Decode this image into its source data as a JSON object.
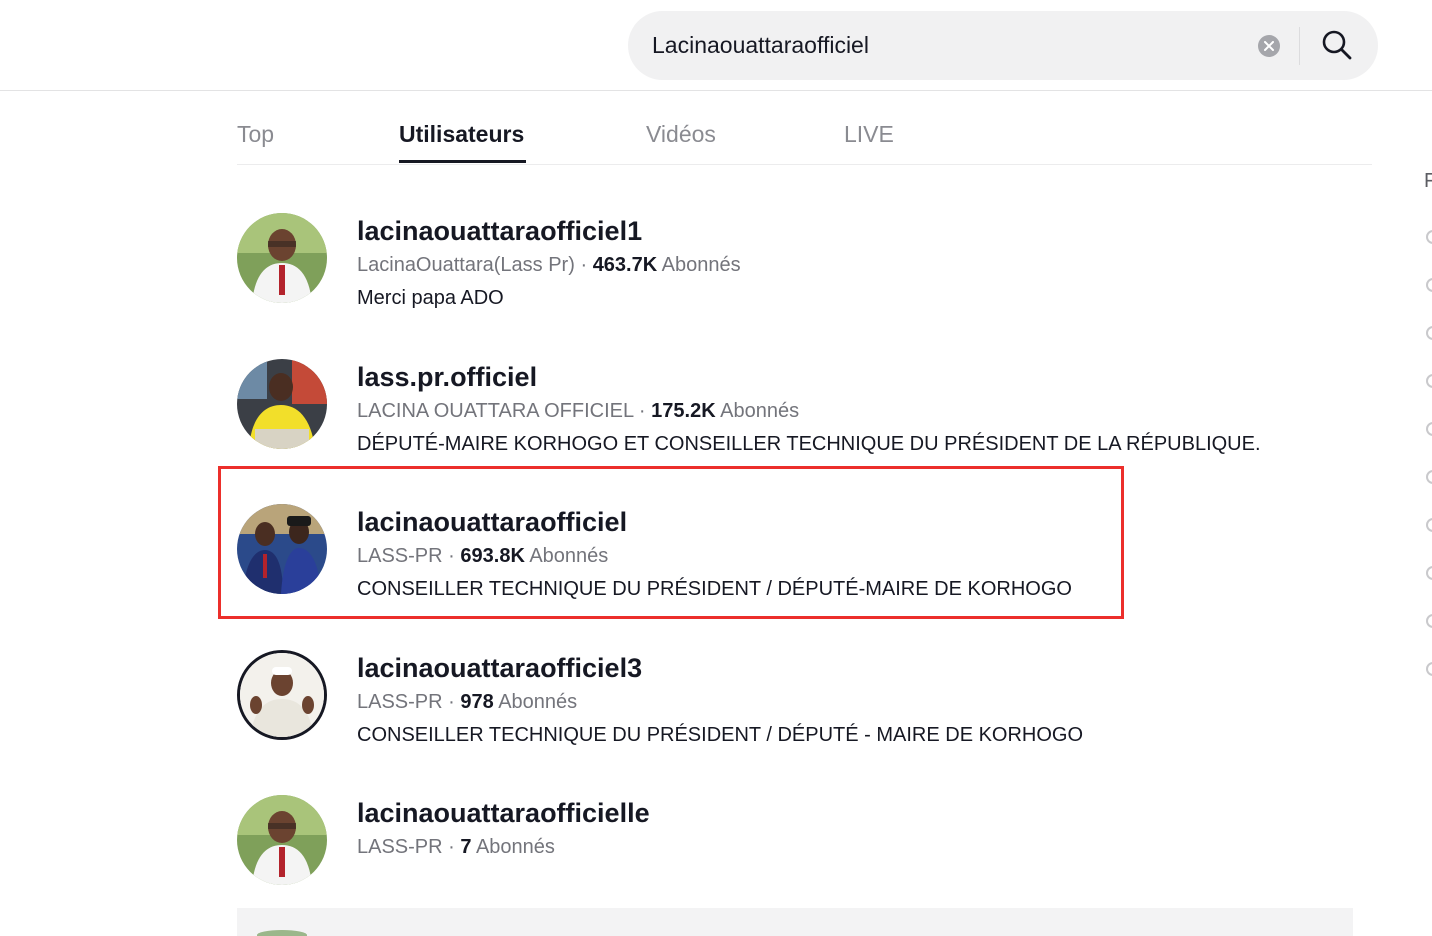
{
  "search": {
    "value": "Lacinaouattaraofficiel",
    "clear_icon": "close-circle-icon",
    "search_icon": "search-icon"
  },
  "tabs": [
    {
      "label": "Top",
      "active": false
    },
    {
      "label": "Utilisateurs",
      "active": true
    },
    {
      "label": "Vidéos",
      "active": false
    },
    {
      "label": "LIVE",
      "active": false
    }
  ],
  "results": [
    {
      "username": "lacinaouattaraofficiel1",
      "display_name": "LacinaOuattara(Lass Pr)",
      "separator": "·",
      "followers": "463.7K",
      "followers_label": "Abonnés",
      "bio": "Merci papa ADO"
    },
    {
      "username": "lass.pr.officiel",
      "display_name": "LACINA OUATTARA OFFICIEL",
      "separator": "·",
      "followers": "175.2K",
      "followers_label": "Abonnés",
      "bio": "DÉPUTÉ-MAIRE KORHOGO ET CONSEILLER TECHNIQUE DU PRÉSIDENT DE LA RÉPUBLIQUE."
    },
    {
      "username": "lacinaouattaraofficiel",
      "display_name": "LASS-PR",
      "separator": "·",
      "followers": "693.8K",
      "followers_label": "Abonnés",
      "bio": "CONSEILLER TECHNIQUE DU PRÉSIDENT / DÉPUTÉ-MAIRE DE KORHOGO",
      "highlighted": true
    },
    {
      "username": "lacinaouattaraofficiel3",
      "display_name": "LASS-PR",
      "separator": "·",
      "followers": "978",
      "followers_label": "Abonnés",
      "bio": "CONSEILLER TECHNIQUE DU PRÉSIDENT / DÉPUTÉ - MAIRE DE KORHOGO"
    },
    {
      "username": "lacinaouattaraofficielle",
      "display_name": "LASS-PR",
      "separator": "·",
      "followers": "7",
      "followers_label": "Abonnés",
      "bio": ""
    }
  ],
  "right_rail": {
    "letter": "F"
  },
  "colors": {
    "highlight": "#ec2f2b",
    "text_primary": "#161823",
    "text_secondary": "#73747b"
  }
}
